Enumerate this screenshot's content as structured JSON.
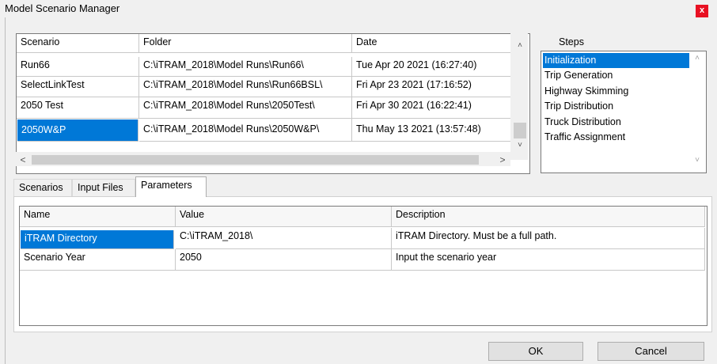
{
  "window": {
    "title": "Model Scenario Manager",
    "close_glyph": "x"
  },
  "scenarios": {
    "columns": [
      "Scenario",
      "Folder",
      "Date"
    ],
    "rows": [
      [
        "Run66",
        "C:\\iTRAM_2018\\Model Runs\\Run66\\",
        "Tue Apr 20 2021 (16:27:40)"
      ],
      [
        "SelectLinkTest",
        "C:\\iTRAM_2018\\Model Runs\\Run66BSL\\",
        "Fri Apr 23 2021 (17:16:52)"
      ],
      [
        "2050 Test",
        "C:\\iTRAM_2018\\Model Runs\\2050Test\\",
        "Fri Apr 30 2021 (16:22:41)"
      ],
      [
        "2050W&P",
        "C:\\iTRAM_2018\\Model Runs\\2050W&P\\",
        "Thu May 13 2021 (13:57:48)"
      ]
    ],
    "selected_row": 3,
    "scroll_up": "˄",
    "scroll_down": "˅",
    "scroll_left": "<",
    "scroll_right": ">"
  },
  "steps": {
    "label": "Steps",
    "items": [
      "Initialization",
      "Trip Generation",
      "Highway Skimming",
      "Trip Distribution",
      "Truck Distribution",
      "Traffic Assignment"
    ],
    "selected": 0,
    "scroll_up": "˄",
    "scroll_down": "˅"
  },
  "tabs": [
    {
      "label": "Scenarios",
      "active": false
    },
    {
      "label": "Input Files",
      "active": false
    },
    {
      "label": "Parameters",
      "active": true
    }
  ],
  "parameters": {
    "columns": [
      "Name",
      "Value",
      "Description"
    ],
    "rows": [
      [
        "iTRAM Directory",
        "C:\\iTRAM_2018\\",
        "iTRAM Directory. Must be a full path."
      ],
      [
        "Scenario Year",
        "2050",
        "Input the scenario year"
      ]
    ],
    "selected_row": 0
  },
  "buttons": {
    "ok": "OK",
    "cancel": "Cancel"
  },
  "colors": {
    "selection": "#0078d7",
    "close": "#e81123"
  }
}
